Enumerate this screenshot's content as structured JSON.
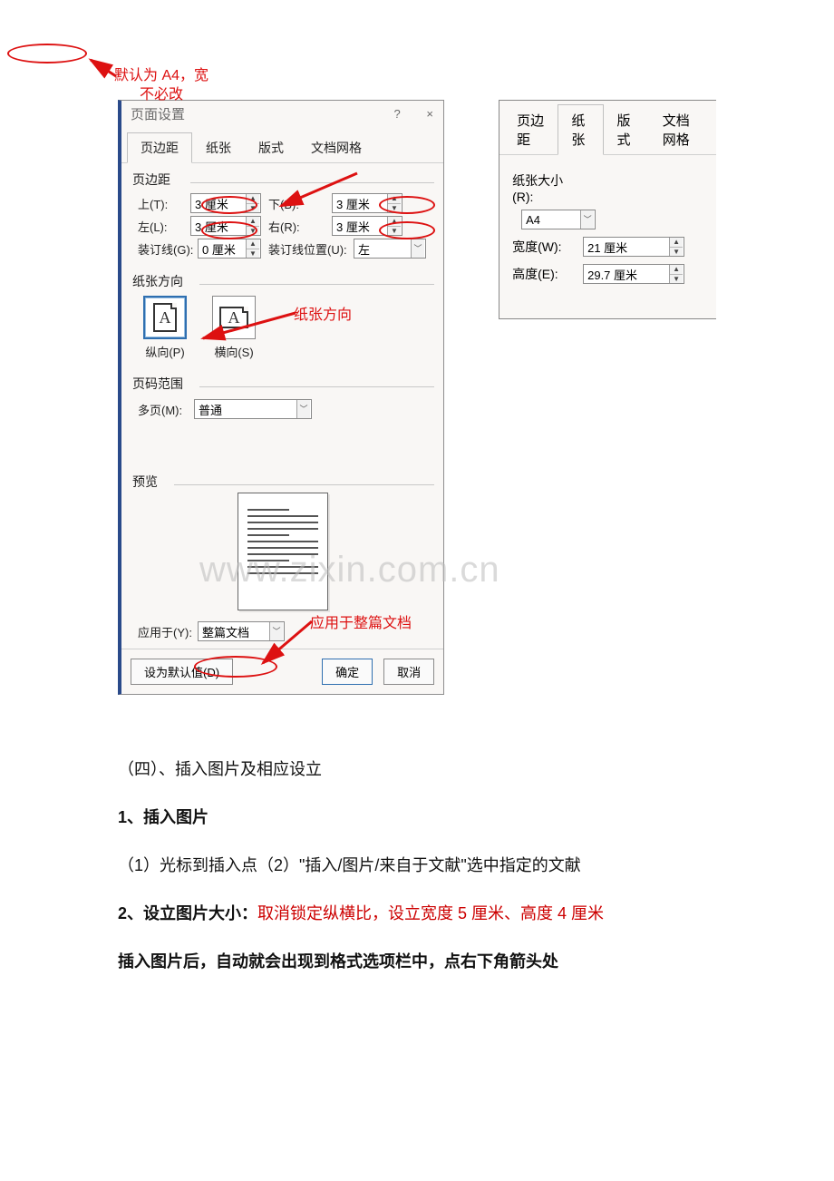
{
  "dialog": {
    "title": "页面设置",
    "help_icon": "?",
    "close_icon": "×",
    "tabs": [
      "页边距",
      "纸张",
      "版式",
      "文档网格"
    ],
    "active_tab_index": 0,
    "groups": {
      "margins_label": "页边距",
      "top_label": "上(T):",
      "top_value": "3 厘米",
      "bottom_label": "下(B):",
      "bottom_value": "3 厘米",
      "left_label": "左(L):",
      "left_value": "3 厘米",
      "right_label": "右(R):",
      "right_value": "3 厘米",
      "gutter_label": "装订线(G):",
      "gutter_value": "0 厘米",
      "gutter_pos_label": "装订线位置(U):",
      "gutter_pos_value": "左"
    },
    "orientation": {
      "label": "纸张方向",
      "portrait": "纵向(P)",
      "landscape": "横向(S)"
    },
    "page_range": {
      "label": "页码范围",
      "pages_label": "多页(M):",
      "pages_value": "普通"
    },
    "preview_label": "预览",
    "apply_to_label": "应用于(Y):",
    "apply_to_value": "整篇文档",
    "buttons": {
      "set_default": "设为默认值(D)",
      "ok": "确定",
      "cancel": "取消"
    }
  },
  "panel2": {
    "tabs": [
      "页边距",
      "纸张",
      "版式",
      "文档网格"
    ],
    "active_tab_index": 1,
    "size_label": "纸张大小(R):",
    "size_value": "A4",
    "width_label": "宽度(W):",
    "width_value": "21 厘米",
    "height_label": "高度(E):",
    "height_value": "29.7 厘米"
  },
  "annotations": {
    "orientation_text": "纸张方向",
    "apply_text": "应用于整篇文档",
    "panel2_note_line1": "默认为 A4，宽",
    "panel2_note_line2": "不必改"
  },
  "watermark": "www.zixin.com.cn",
  "bodytext": {
    "p1": "（四）、插入图片及相应设立",
    "p2": "1、插入图片",
    "p3": "（1）光标到插入点（2）\"插入/图片/来自于文献\"选中指定的文献",
    "p4a": "2、设立图片大小：",
    "p4b": "取消锁定纵横比，设立宽度 5 厘米、高度 4 厘米",
    "p5": "插入图片后，自动就会出现到格式选项栏中，点右下角箭头处"
  }
}
